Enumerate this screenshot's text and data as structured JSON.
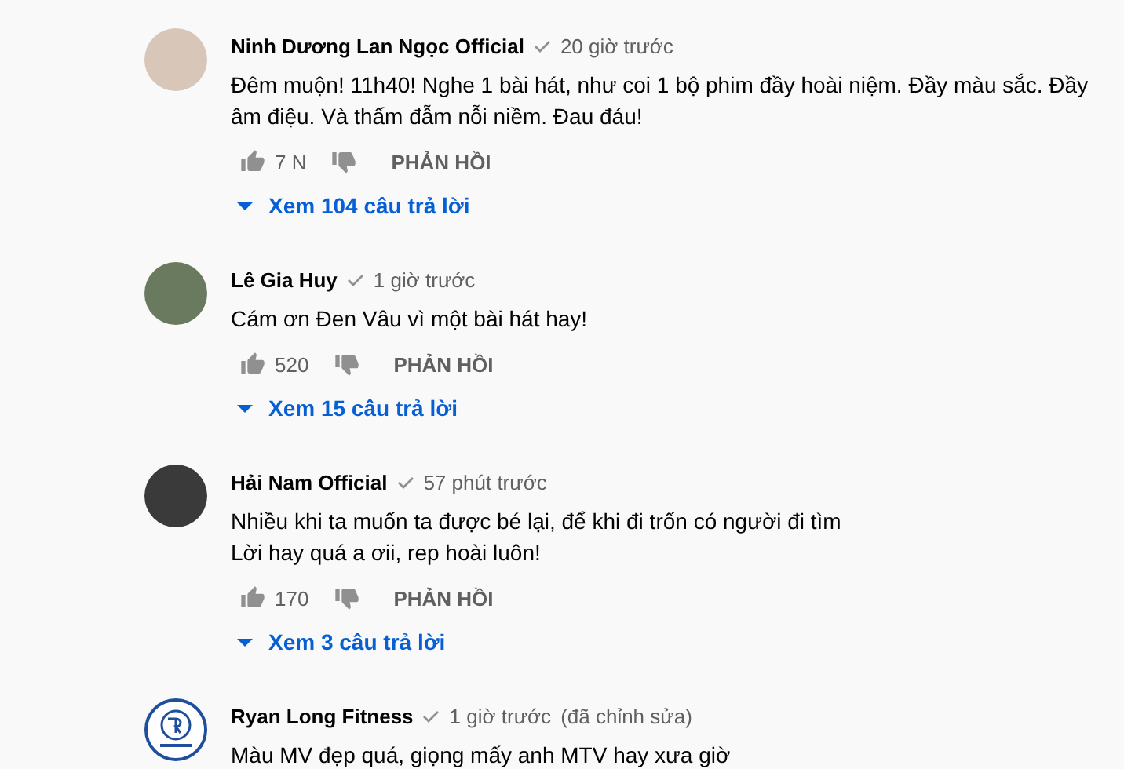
{
  "comments": [
    {
      "author": "Ninh Dương Lan Ngọc Official",
      "verified": true,
      "time": "20 giờ trước",
      "kind": "photo",
      "text": "Đêm muộn! 11h40! Nghe 1 bài hát, như coi 1 bộ phim đầy hoài niệm. Đầy màu sắc. Đầy âm điệu. Và thấm đẫm nỗi niềm. Đau đáu!",
      "likes": "7 N",
      "reply_button": "PHẢN HỒI",
      "replies_link": "Xem 104 câu trả lời"
    },
    {
      "author": "Lê Gia Huy",
      "verified": true,
      "time": "1 giờ trước",
      "kind": "photo",
      "text": "Cám ơn Đen Vâu vì một bài hát hay!",
      "likes": "520",
      "reply_button": "PHẢN HỒI",
      "replies_link": "Xem 15 câu trả lời"
    },
    {
      "author": "Hải Nam Official",
      "verified": true,
      "time": "57 phút trước",
      "kind": "photo",
      "text": "Nhiều khi ta muốn ta được bé lại, để khi đi trốn có người đi tìm\nLời hay quá a ơii, rep hoài luôn!",
      "likes": "170",
      "reply_button": "PHẢN HỒI",
      "replies_link": "Xem 3 câu trả lời"
    },
    {
      "author": "Ryan Long Fitness",
      "verified": true,
      "time": "1 giờ trước",
      "edited": "(đã chỉnh sửa)",
      "kind": "logo",
      "text": "Màu MV đẹp quá, giọng mấy anh MTV hay xưa giờ"
    }
  ]
}
